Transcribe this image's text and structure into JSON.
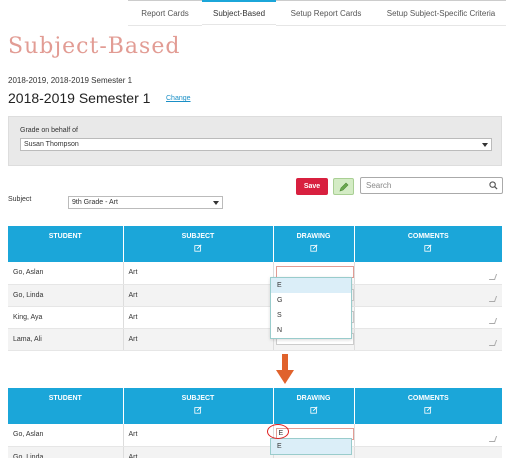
{
  "tabs": [
    {
      "label": "Report Cards",
      "active": false
    },
    {
      "label": "Subject-Based",
      "active": true
    },
    {
      "label": "Setup Report Cards",
      "active": false
    },
    {
      "label": "Setup Subject-Specific Criteria",
      "active": false
    }
  ],
  "page_title": "Subject-Based",
  "term": {
    "list": "2018-2019, 2018-2019 Semester 1",
    "current": "2018-2019 Semester 1",
    "change_label": "Change"
  },
  "behalf": {
    "label": "Grade on behalf of",
    "value": "Susan Thompson"
  },
  "toolbar": {
    "save_label": "Save",
    "search_placeholder": "Search"
  },
  "subject": {
    "label": "Subject",
    "value": "9th Grade - Art"
  },
  "columns": [
    "STUDENT",
    "SUBJECT",
    "DRAWING",
    "COMMENTS"
  ],
  "rows": [
    {
      "student": "Go, Aslan",
      "subject": "Art"
    },
    {
      "student": "Go, Linda",
      "subject": "Art"
    },
    {
      "student": "King, Aya",
      "subject": "Art"
    },
    {
      "student": "Lama, Ali",
      "subject": "Art"
    }
  ],
  "dropdown_options": [
    "E",
    "G",
    "S",
    "N"
  ],
  "second_table": {
    "rows": [
      {
        "student": "Go, Aslan",
        "subject": "Art",
        "drawing_value": "E"
      },
      {
        "student": "Go, Linda",
        "subject": "Art"
      }
    ],
    "dropdown_options": [
      "E"
    ]
  },
  "colors": {
    "accent": "#1ba6d9",
    "save": "#d8203f",
    "title": "#e29c94",
    "arrow": "#e0622c"
  }
}
